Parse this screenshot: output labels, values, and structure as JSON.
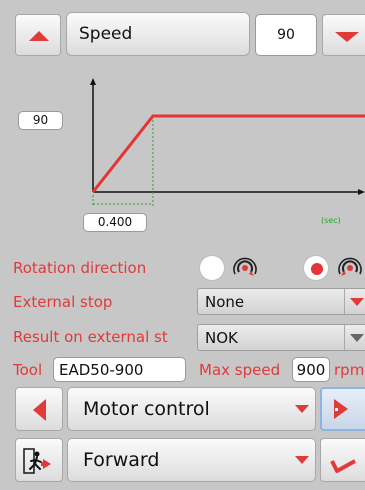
{
  "header": {
    "param_label": "Speed",
    "param_value": "90"
  },
  "chart_data": {
    "type": "line",
    "x": [
      0,
      0.4,
      1
    ],
    "y": [
      0,
      90,
      90
    ],
    "y_value_label": "90",
    "x_value_label": "0.400",
    "x_unit": "(sec)",
    "line_color": "#e63333",
    "marker_color": "#2aa02a"
  },
  "settings": {
    "rotation_direction": {
      "label": "Rotation direction",
      "selected": 1
    },
    "external_stop": {
      "label": "External stop",
      "value": "None"
    },
    "result_external_stop": {
      "label": "Result on external st",
      "value": "NOK"
    },
    "tool": {
      "label": "Tool",
      "value": "EAD50-900"
    },
    "max_speed": {
      "label": "Max speed",
      "value": "900",
      "unit": "rpm"
    }
  },
  "nav": {
    "mode": "Motor control",
    "direction": "Forward"
  },
  "colors": {
    "accent": "#e03a3a",
    "background": "#c7c7c7"
  }
}
